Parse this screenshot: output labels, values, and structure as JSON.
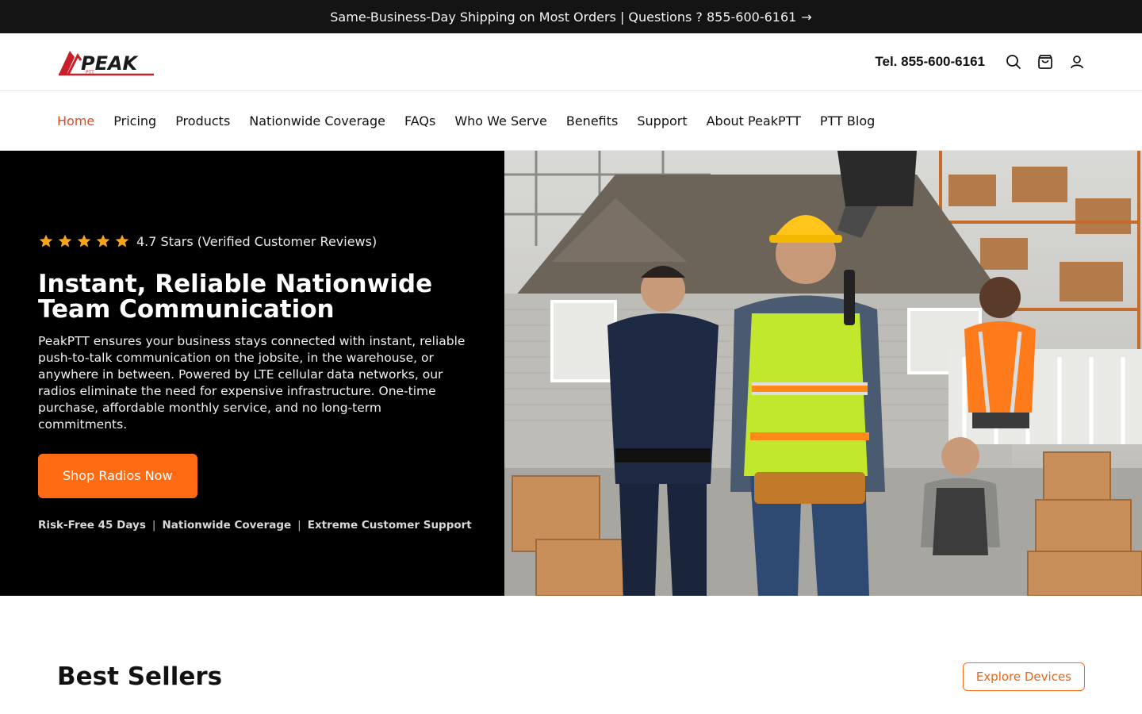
{
  "announcement": {
    "text": "Same-Business-Day Shipping on Most Orders | Questions ? 855-600-6161",
    "arrow": "→"
  },
  "header": {
    "logo_text": "PEAK",
    "logo_sub": "PTT",
    "tel": "Tel. 855-600-6161",
    "icons": [
      "search-icon",
      "cart-icon",
      "account-icon"
    ]
  },
  "nav": {
    "items": [
      {
        "label": "Home",
        "active": true
      },
      {
        "label": "Pricing"
      },
      {
        "label": "Products"
      },
      {
        "label": "Nationwide Coverage"
      },
      {
        "label": "FAQs"
      },
      {
        "label": "Who We Serve"
      },
      {
        "label": "Benefits"
      },
      {
        "label": "Support"
      },
      {
        "label": "About PeakPTT"
      },
      {
        "label": "PTT Blog"
      }
    ]
  },
  "hero": {
    "rating_text": "4.7 Stars (Verified Customer Reviews)",
    "title": "Instant, Reliable Nationwide Team Communication",
    "body": "PeakPTT ensures your business stays connected with instant, reliable push-to-talk communication on the jobsite, in the warehouse, or anywhere in between. Powered by LTE cellular data networks, our radios eliminate the need for expensive infrastructure. One-time purchase, affordable monthly service, and no long-term commitments.",
    "cta": "Shop Radios Now",
    "benefits": [
      "Risk-Free 45 Days",
      "Nationwide Coverage",
      "Extreme Customer Support"
    ]
  },
  "best_sellers": {
    "title": "Best Sellers",
    "button": "Explore Devices"
  },
  "colors": {
    "accent": "#ff6b12",
    "nav_active": "#e14a1f",
    "star": "#f7a21b",
    "logo_red": "#c8202a"
  }
}
